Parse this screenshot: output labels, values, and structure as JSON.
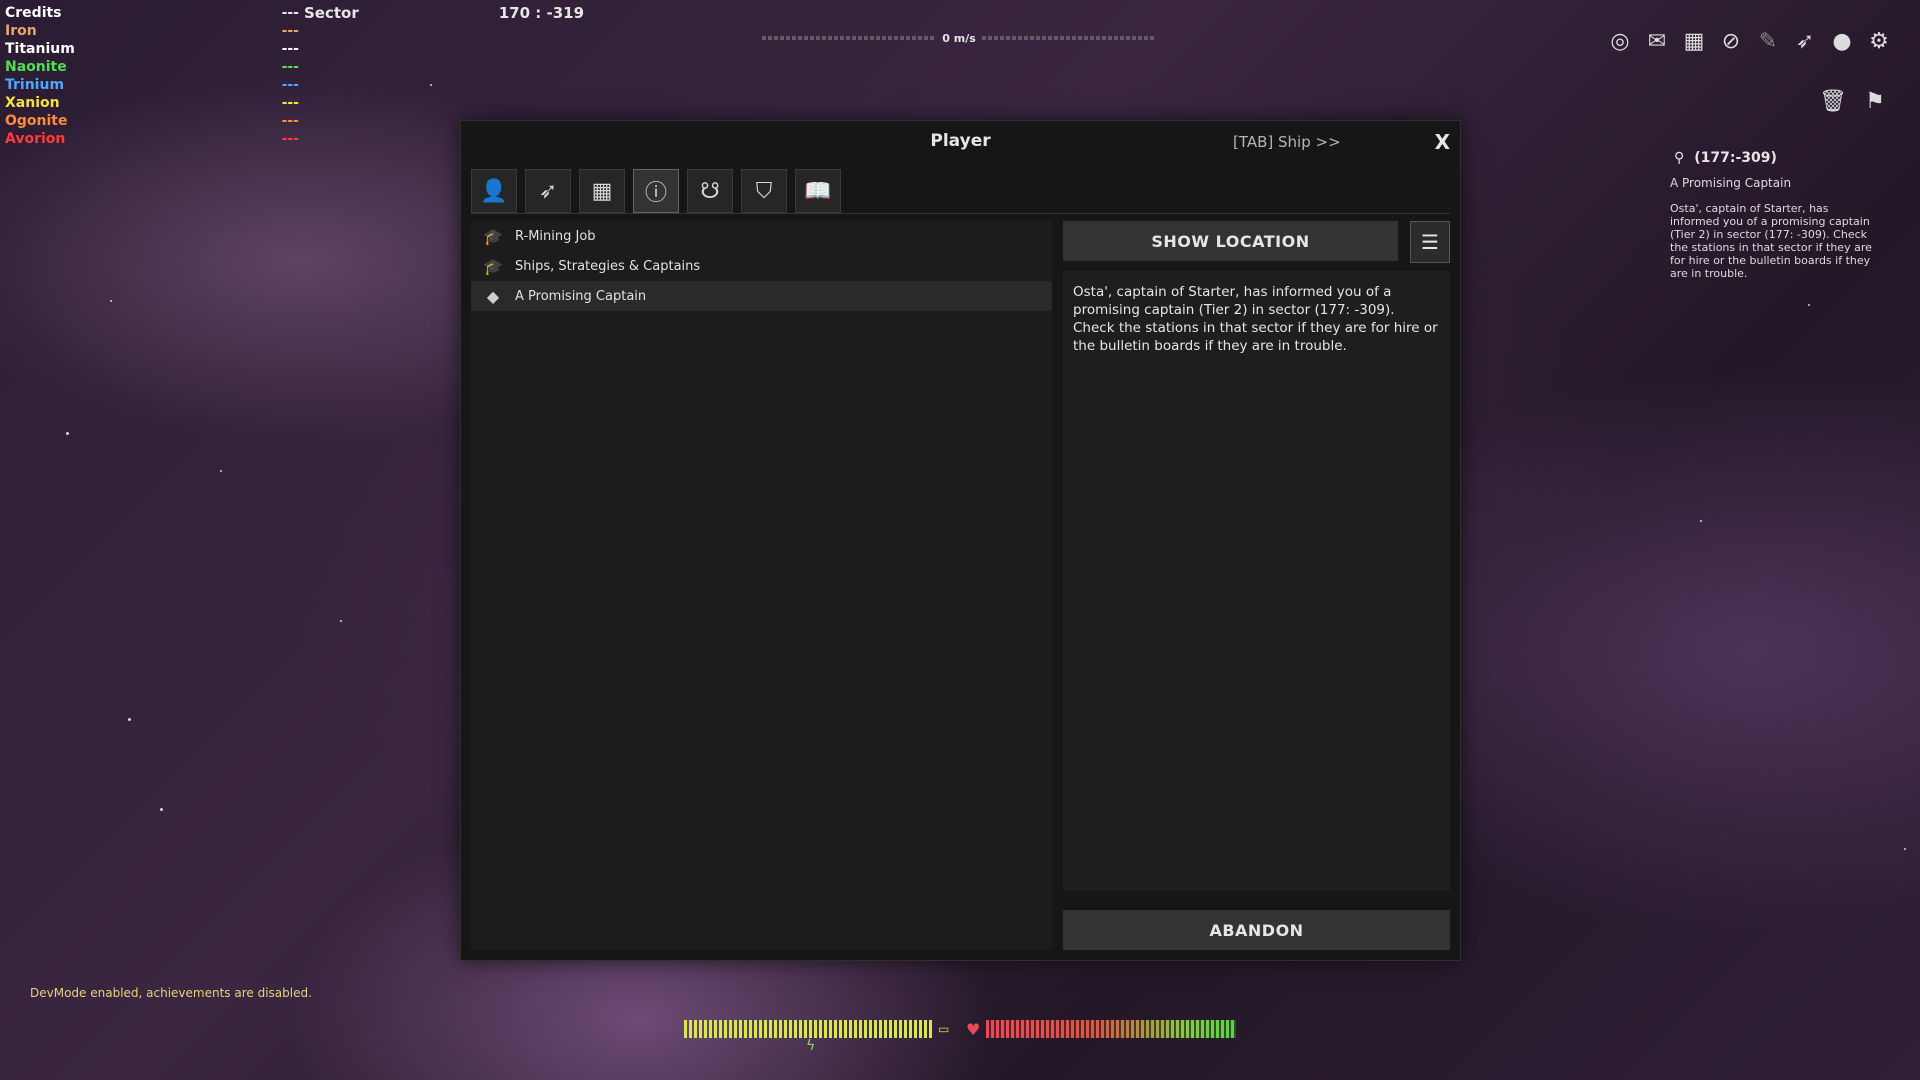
{
  "resources": {
    "credits": {
      "label": "Credits",
      "value": "---",
      "color": "#ffffff"
    },
    "items": [
      {
        "label": "Iron",
        "value": "---",
        "color": "#e8a66a"
      },
      {
        "label": "Titanium",
        "value": "---",
        "color": "#ffffff"
      },
      {
        "label": "Naonite",
        "value": "---",
        "color": "#4fe04f"
      },
      {
        "label": "Trinium",
        "value": "---",
        "color": "#4fa6ff"
      },
      {
        "label": "Xanion",
        "value": "---",
        "color": "#f2e23a"
      },
      {
        "label": "Ogonite",
        "value": "---",
        "color": "#ff8a3a"
      },
      {
        "label": "Avorion",
        "value": "---",
        "color": "#ff3a3a"
      }
    ]
  },
  "sector": {
    "label": "Sector",
    "coords": "170 : -319"
  },
  "speed": {
    "text": "0 m/s"
  },
  "top_icons": [
    "radar-icon",
    "mail-icon",
    "strategy-icon",
    "compass-icon",
    "build-icon",
    "ship-icon",
    "player-icon",
    "settings-icon"
  ],
  "top_tools": [
    "trash-icon",
    "flag-icon"
  ],
  "tracker": {
    "location": "(177:-309)",
    "title": "A Promising Captain",
    "description": "Osta', captain of Starter, has informed you of a promising captain (Tier 2) in sector (177: -309). Check the stations in that sector if they are for hire or the bulletin boards if they are in trouble."
  },
  "window": {
    "title": "Player",
    "tab_ship": "[TAB] Ship  >>",
    "close": "X",
    "tabs": [
      "player-tab-icon",
      "ships-tab-icon",
      "inventory-tab-icon",
      "missions-tab-icon",
      "relations-tab-icon",
      "alliance-tab-icon",
      "codex-tab-icon"
    ],
    "missions": [
      {
        "label": "R-Mining Job",
        "icon": "tutorial-icon"
      },
      {
        "label": "Ships, Strategies & Captains",
        "icon": "tutorial-icon"
      },
      {
        "label": "A Promising Captain",
        "icon": "mission-diamond-icon"
      }
    ],
    "show_location": "SHOW LOCATION",
    "description": "Osta', captain of Starter, has informed you of a promising captain (Tier 2) in sector (177: -309). Check the stations in that sector if they are for hire or the bulletin boards if they are in trouble.",
    "abandon": "ABANDON"
  },
  "devmode": "DevMode enabled, achievements are disabled.",
  "status": {
    "energy_color": "#d7e84a",
    "hull_color": "#e84a5a"
  }
}
